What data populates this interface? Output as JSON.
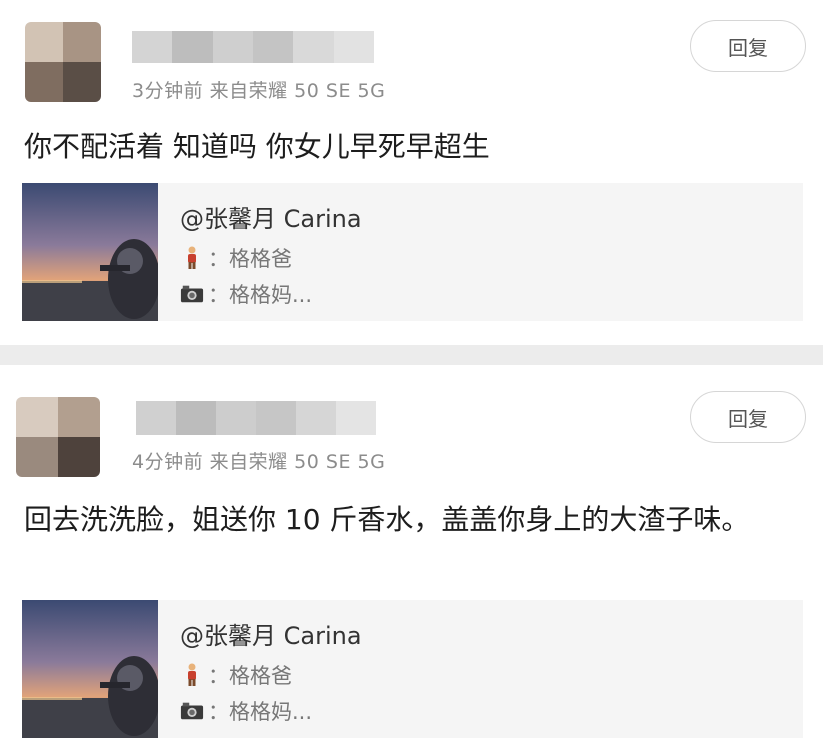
{
  "comments": [
    {
      "meta": "3分钟前  来自荣耀 50 SE 5G",
      "reply_label": "回复",
      "text": "你不配活着 知道吗 你女儿早死早超生",
      "quote": {
        "title": "@张馨月 Carina",
        "line1": "：格格爸",
        "line2": "：格格妈..."
      }
    },
    {
      "meta": "4分钟前  来自荣耀 50 SE 5G",
      "reply_label": "回复",
      "text": "回去洗洗脸，姐送你 10 斤香水，盖盖你身上的大渣子味。",
      "quote": {
        "title": "@张馨月 Carina",
        "line1": "：格格爸",
        "line2": "：格格妈..."
      }
    }
  ],
  "icons": {
    "line1_icon": "person-figure-icon",
    "line2_icon": "camera-icon"
  },
  "colors": {
    "meta_gray": "#8c8c8c",
    "quote_bg": "#f5f5f5",
    "divider": "#ececec"
  }
}
